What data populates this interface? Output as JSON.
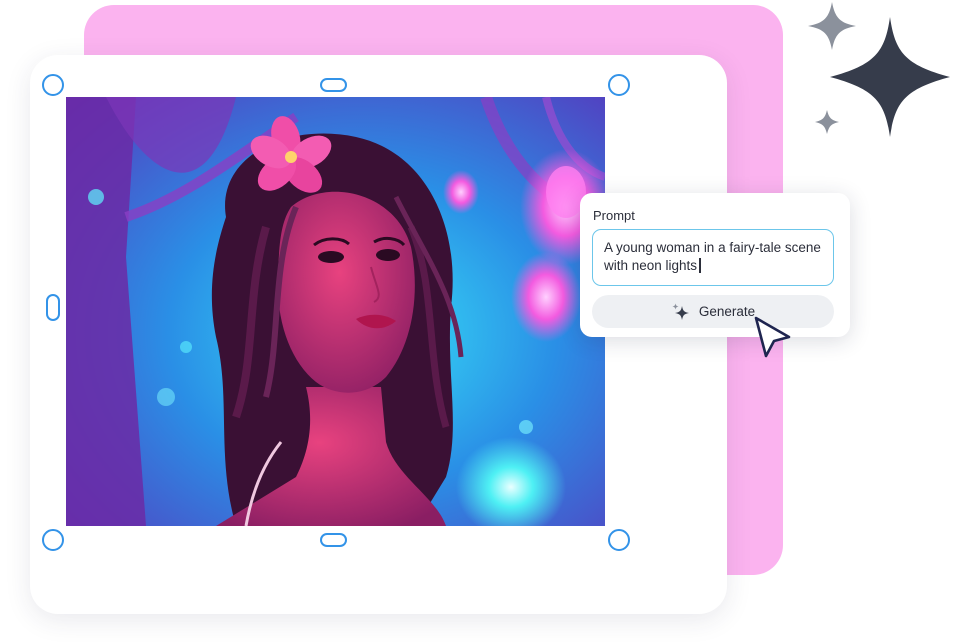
{
  "canvas": {
    "image_alt": "Neon-lit portrait of a young woman with a pink flower in her hair in a glowing fairy-tale forest"
  },
  "prompt_panel": {
    "label": "Prompt",
    "input_value": "A young woman in a fairy-tale scene with neon lights",
    "generate_label": "Generate"
  },
  "icons": {
    "sparkle": "sparkle-icon",
    "cursor": "mouse-pointer-icon"
  },
  "colors": {
    "accent_blue": "#3393e8",
    "pink_backdrop": "#fbb3ef",
    "sparkle_dark": "#363c4b",
    "sparkle_gray": "#8b919c",
    "input_border": "#6cc6ea"
  }
}
